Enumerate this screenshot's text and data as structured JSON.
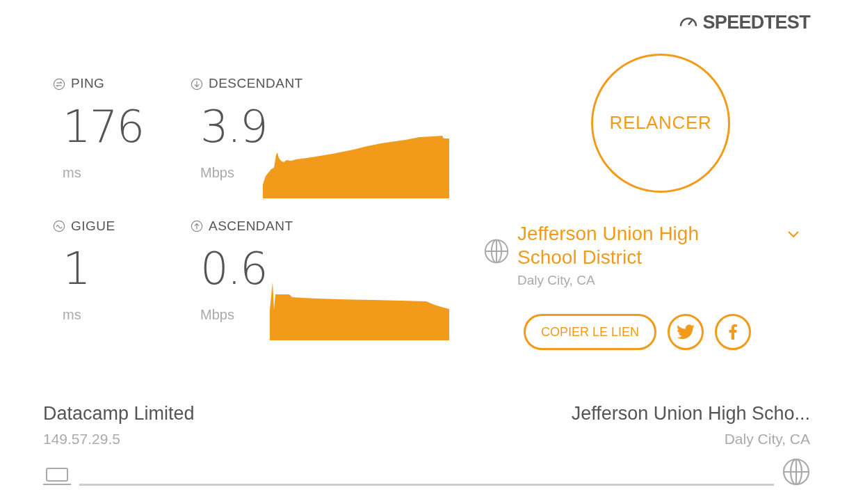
{
  "brand": {
    "name": "SPEEDTEST"
  },
  "metrics": [
    {
      "kind": "ping",
      "label": "PING",
      "value": "176",
      "unit": "ms"
    },
    {
      "kind": "download",
      "label": "DESCENDANT",
      "value": "3.9",
      "unit": "Mbps"
    },
    {
      "kind": "jitter",
      "label": "GIGUE",
      "value": "1",
      "unit": "ms"
    },
    {
      "kind": "upload",
      "label": "ASCENDANT",
      "value": "0.6",
      "unit": "Mbps"
    }
  ],
  "restart_button": {
    "label": "RELANCER"
  },
  "server": {
    "name": "Jefferson Union High School District",
    "location": "Daly City, CA"
  },
  "share": {
    "copy_link": "COPIER LE LIEN"
  },
  "footer": {
    "client": {
      "name": "Datacamp Limited",
      "ip": "149.57.29.5"
    },
    "server": {
      "name": "Jefferson Union High Scho...",
      "location": "Daly City, CA"
    }
  }
}
